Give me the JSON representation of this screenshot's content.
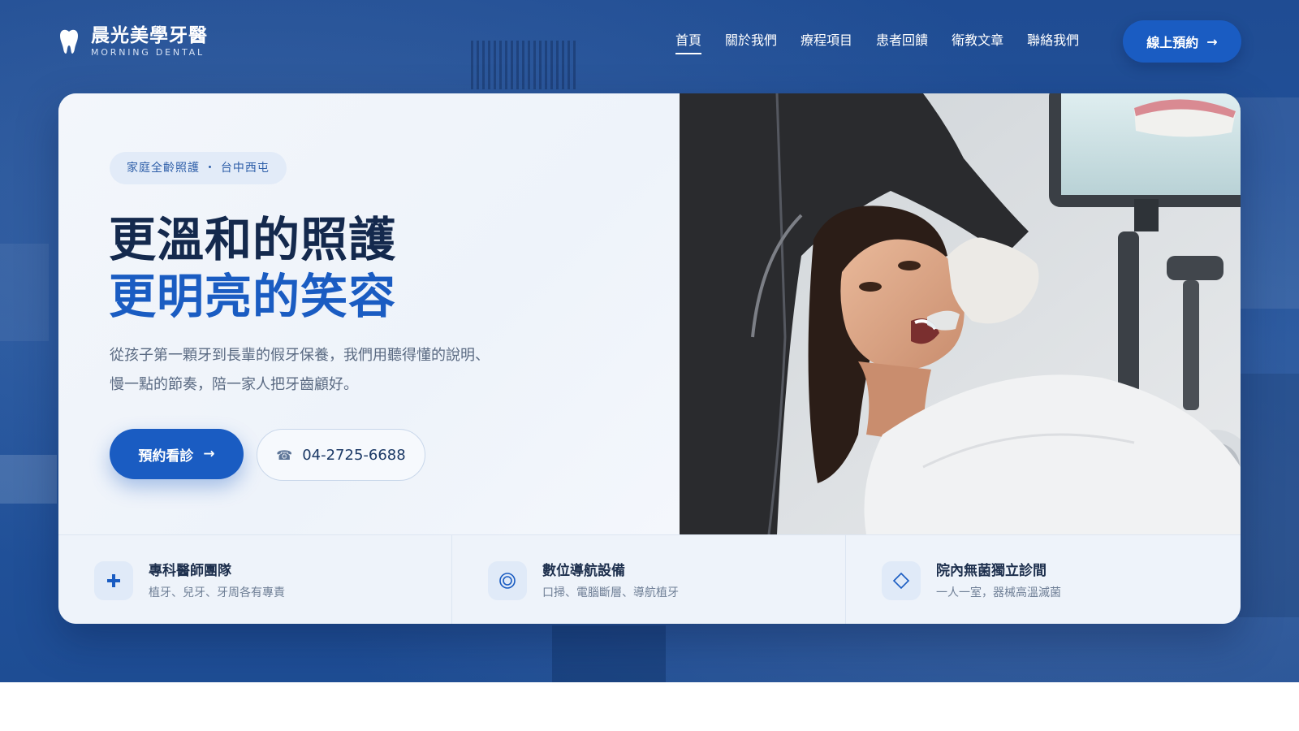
{
  "brand": {
    "name": "晨光美學牙醫",
    "subtitle": "MORNING DENTAL",
    "icon": "tooth-icon"
  },
  "nav": {
    "items": [
      {
        "label": "首頁",
        "active": true
      },
      {
        "label": "關於我們",
        "active": false
      },
      {
        "label": "療程項目",
        "active": false
      },
      {
        "label": "患者回饋",
        "active": false
      },
      {
        "label": "衛教文章",
        "active": false
      },
      {
        "label": "聯絡我們",
        "active": false
      }
    ],
    "cta_label": "線上預約",
    "cta_arrow": "→"
  },
  "hero": {
    "tag": "家庭全齡照護 ・ 台中西屯",
    "title_line1": "更溫和的照護",
    "title_line2": "更明亮的笑容",
    "description": "從孩子第一顆牙到長輩的假牙保養，我們用聽得懂的說明、慢一點的節奏，陪一家人把牙齒顧好。",
    "book_label": "預約看診",
    "book_arrow": "→",
    "phone_icon": "☎",
    "phone": "04-2725-6688"
  },
  "features": [
    {
      "icon": "plus-icon",
      "glyph": "+",
      "title": "專科醫師團隊",
      "subtitle": "植牙、兒牙、牙周各有專責"
    },
    {
      "icon": "target-icon",
      "glyph": "◎",
      "title": "數位導航設備",
      "subtitle": "口掃、電腦斷層、導航植牙"
    },
    {
      "icon": "diamond-icon",
      "glyph": "◇",
      "title": "院內無菌獨立診間",
      "subtitle": "一人一室，器械高溫滅菌"
    }
  ],
  "colors": {
    "primary": "#1a5cc2",
    "hero_bg": "#1f4c93",
    "title_dark": "#14294d",
    "card_bg": "#eef3fa"
  }
}
